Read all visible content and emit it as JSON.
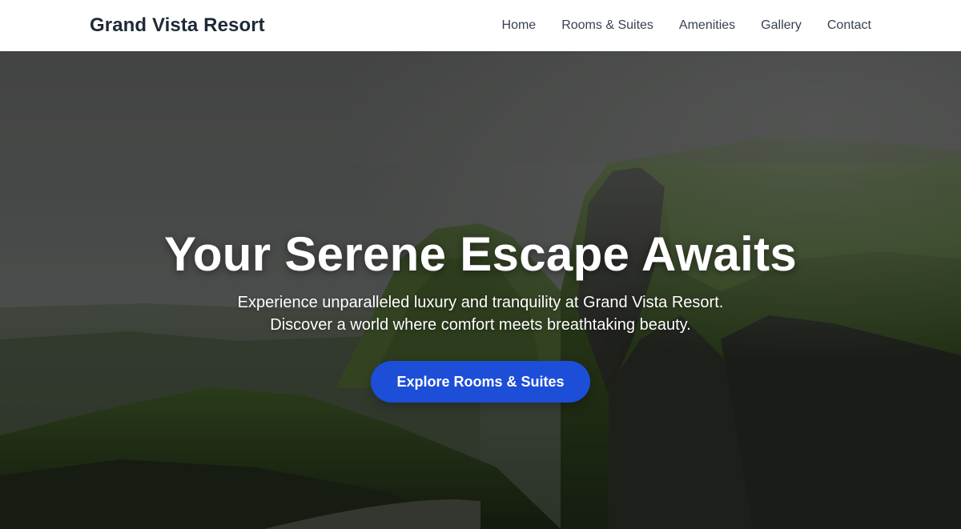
{
  "header": {
    "brand": "Grand Vista Resort",
    "nav": [
      {
        "label": "Home"
      },
      {
        "label": "Rooms & Suites"
      },
      {
        "label": "Amenities"
      },
      {
        "label": "Gallery"
      },
      {
        "label": "Contact"
      }
    ]
  },
  "hero": {
    "title": "Your Serene Escape Awaits",
    "subtitle_line1": "Experience unparalleled luxury and tranquility at Grand Vista Resort.",
    "subtitle_line2": "Discover a world where comfort meets breathtaking beauty.",
    "cta_label": "Explore Rooms & Suites",
    "background_image": "misty-green-cliffs-landscape"
  },
  "colors": {
    "header_bg": "#ffffff",
    "brand_text": "#1f2937",
    "nav_text": "#374151",
    "cta_bg": "#1d4ed8",
    "hero_text": "#ffffff"
  }
}
